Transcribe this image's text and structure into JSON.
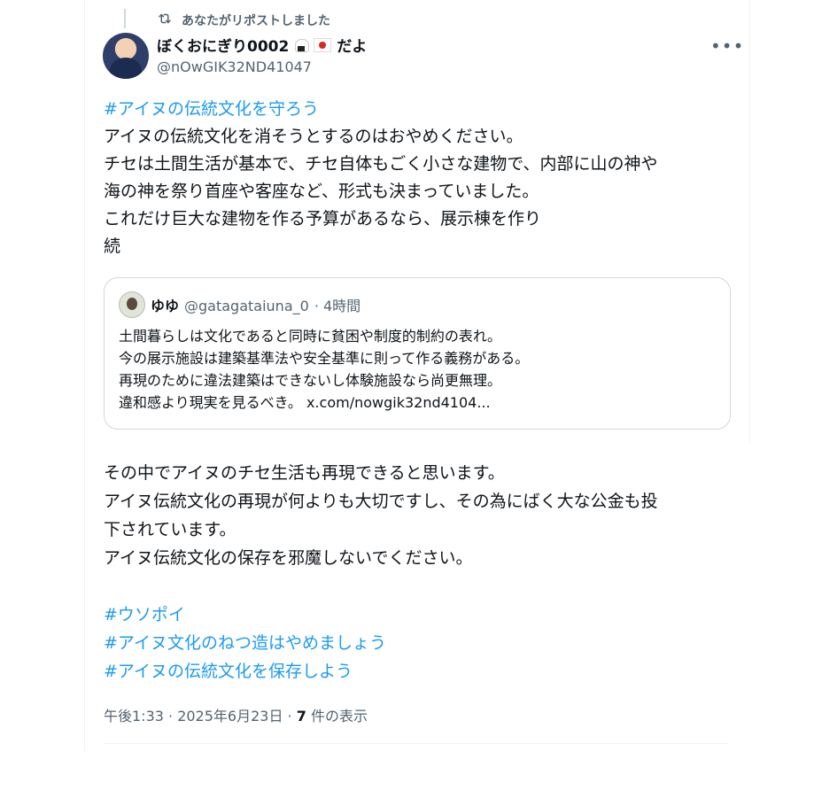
{
  "repost": {
    "label": "あなたがリポストしました"
  },
  "author": {
    "name": "ぼくおにぎり0002",
    "name_suffix": "だよ",
    "handle": "@nOwGIK32ND41047"
  },
  "tweet": {
    "hashtag_top": "#アイヌの伝統文化を守ろう",
    "lines": [
      "アイヌの伝統文化を消そうとするのはおやめください。",
      "チセは土間生活が基本で、チセ自体もごく小さな建物で、内部に山の神や",
      "海の神を祭り首座や客座など、形式も決まっていました。",
      "これだけ巨大な建物を作る予算があるなら、展示棟を作り",
      "続"
    ]
  },
  "quote": {
    "name": "ゆゆ",
    "handle": "@gatagataiuna_0",
    "time": "· 4時間",
    "lines": [
      "土間暮らしは文化であると同時に貧困や制度的制約の表れ。",
      "今の展示施設は建築基準法や安全基準に則って作る義務がある。",
      "再現のために違法建築はできないし体験施設なら尚更無理。",
      "違和感より現実を見るべき。 x.com/nowgik32nd4104..."
    ]
  },
  "continuation": {
    "lines": [
      "その中でアイヌのチセ生活も再現できると思います。",
      "アイヌ伝統文化の再現が何よりも大切ですし、その為にばく大な公金も投",
      "下されています。",
      "アイヌ伝統文化の保存を邪魔しないでください。"
    ],
    "hashtags": [
      "#ウソポイ",
      "#アイヌ文化のねつ造はやめましょう",
      "#アイヌの伝統文化を保存しよう"
    ]
  },
  "meta": {
    "time": "午後1:33 · 2025年6月23日 · ",
    "views_count": "7",
    "views_label": " 件の表示"
  },
  "icons": {
    "repost": "repost-icon",
    "more": "more-icon"
  },
  "colors": {
    "accent": "#1d9bf0",
    "secondary_text": "#536471",
    "border": "#cfd9de"
  }
}
